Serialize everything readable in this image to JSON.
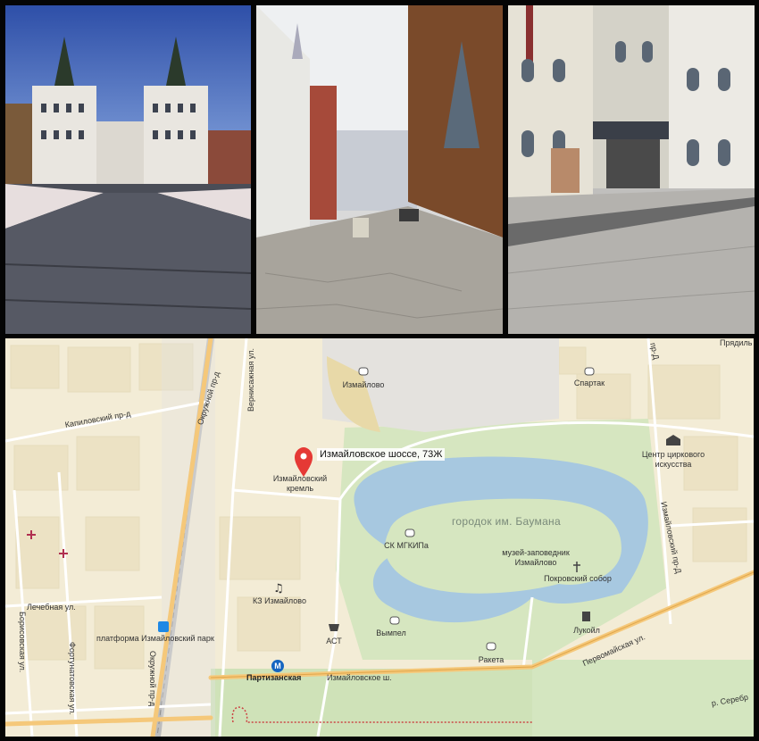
{
  "map": {
    "address": "Измайловское шоссе, 73Ж",
    "park_name": "городок им. Баумана",
    "places": {
      "izmailovo_stadium": "Измайлово",
      "spartak": "Спартак",
      "kremlin": "Измайловский кремль",
      "circus_center": "Центр циркового искусства",
      "sk_mgkipa": "СК МГКИПа",
      "museum": "музей-заповедник Измайлово",
      "cathedral": "Покровский собор",
      "concert_hall": "КЗ Измайлово",
      "ast": "АСТ",
      "vympel": "Вымпел",
      "lukoil": "Лукойл",
      "raketa": "Ракета",
      "platform": "платформа Измайловский парк",
      "metro": "Партизанская"
    },
    "streets": {
      "vernisazhnaya": "Вернисажная ул.",
      "okruzhnoy_top": "Окружной пр-д",
      "okruzhnoy_bottom": "Окружной пр-д",
      "kapilovsky": "Капиловский пр-д",
      "lechebnaya": "Лечебная ул.",
      "borisovskaya": "Борисовская ул.",
      "fortunatovskaya": "Фортунатовская ул.",
      "izmailovskoe_sh": "Измайловское ш.",
      "pervomayskaya": "Первомайская ул.",
      "izmailovsky_pr": "Измайловский пр-Д",
      "unknown_pr": "пр-Д",
      "pryadilnaya": "Прядиль",
      "serebryanka": "р. Серебр"
    },
    "colors": {
      "water": "#a7c8e0",
      "park": "#cfe2b8",
      "road_major": "#f5c87a",
      "pin": "#e53935"
    }
  }
}
